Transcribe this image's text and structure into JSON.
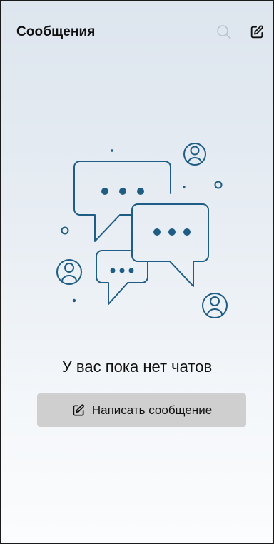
{
  "header": {
    "title": "Сообщения",
    "search_icon": "search-icon",
    "compose_icon": "compose-icon"
  },
  "empty_state": {
    "illustration": "chat-bubbles-illustration",
    "message": "У вас пока нет чатов",
    "button_label": "Написать сообщение",
    "button_icon": "compose-icon"
  },
  "colors": {
    "illustration": "#1f5d85",
    "button_bg": "#cfcfcf",
    "text": "#111111"
  }
}
